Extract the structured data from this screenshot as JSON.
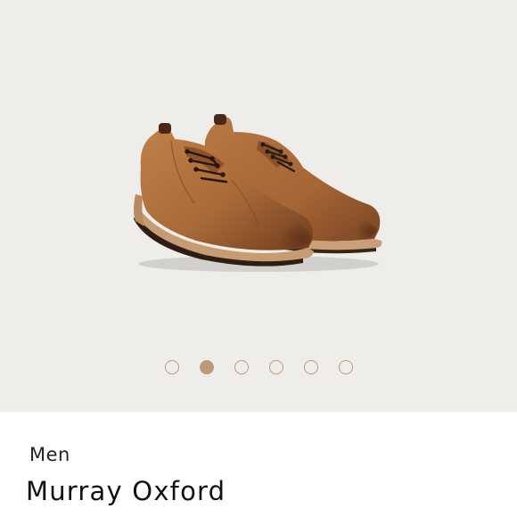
{
  "product": {
    "category": "Men",
    "name": "Murray Oxford"
  },
  "gallery": {
    "slide_count": 6,
    "active_index": 1
  },
  "colors": {
    "gallery_background": "#efedea",
    "dot_accent": "#b99b79",
    "shoe_leather": "#a8693a"
  },
  "icons": {
    "product_image": "brown-suede-oxford-shoes-pair"
  }
}
